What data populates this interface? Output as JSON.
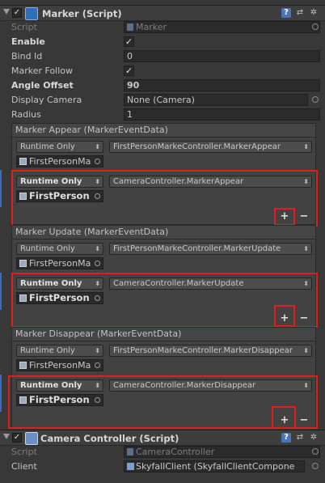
{
  "marker_script": {
    "title": "Marker (Script)",
    "enabled_mark": "✓",
    "help": "?",
    "preset": "⇄",
    "gear": "✲",
    "fields": {
      "script_label": "Script",
      "script_value": "Marker",
      "enable_label": "Enable",
      "enable_mark": "✓",
      "bind_id_label": "Bind Id",
      "bind_id_value": "0",
      "marker_follow_label": "Marker Follow",
      "marker_follow_mark": "✓",
      "angle_offset_label": "Angle Offset",
      "angle_offset_value": "90",
      "display_camera_label": "Display Camera",
      "display_camera_value": "None (Camera)",
      "radius_label": "Radius",
      "radius_value": "1"
    },
    "events": [
      {
        "header": "Marker Appear (MarkerEventData)",
        "listeners": [
          {
            "mode": "Runtime Only",
            "function": "FirstPersonMarkeController.MarkerAppear",
            "object": "FirstPersonMa"
          },
          {
            "mode": "Runtime Only",
            "function": "CameraController.MarkerAppear",
            "object": "FirstPerson"
          }
        ],
        "plus": "+",
        "minus": "−"
      },
      {
        "header": "Marker Update (MarkerEventData)",
        "listeners": [
          {
            "mode": "Runtime Only",
            "function": "FirstPersonMarkeController.MarkerUpdate",
            "object": "FirstPersonMa"
          },
          {
            "mode": "Runtime Only",
            "function": "CameraController.MarkerUpdate",
            "object": "FirstPerson"
          }
        ],
        "plus": "+",
        "minus": "−"
      },
      {
        "header": "Marker Disappear (MarkerEventData)",
        "listeners": [
          {
            "mode": "Runtime Only",
            "function": "FirstPersonMarkeController.MarkerDisappear",
            "object": "FirstPersonMa"
          },
          {
            "mode": "Runtime Only",
            "function": "CameraController.MarkerDisappear",
            "object": "FirstPerson"
          }
        ],
        "plus": "+",
        "minus": "−"
      }
    ]
  },
  "camera_controller": {
    "title": "Camera Controller (Script)",
    "enabled_mark": "✓",
    "help": "?",
    "preset": "⇄",
    "gear": "✲",
    "script_label": "Script",
    "script_value": "CameraController",
    "client_label": "Client",
    "client_value": "SkyfallClient (SkyfallClientCompone"
  },
  "colors": {
    "highlight": "#e01e1e",
    "accent": "#3c6cc0"
  }
}
